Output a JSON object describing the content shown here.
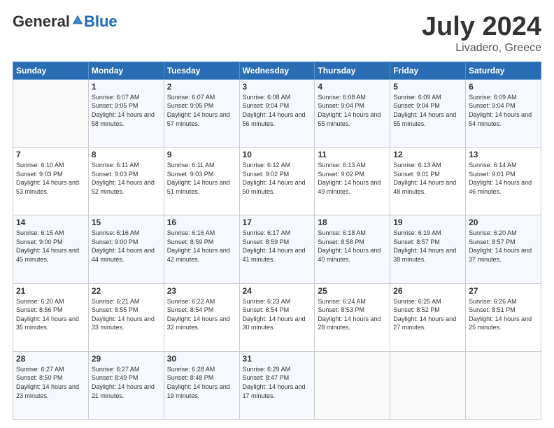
{
  "header": {
    "logo_general": "General",
    "logo_blue": "Blue",
    "title": "July 2024",
    "location": "Livadero, Greece"
  },
  "days_of_week": [
    "Sunday",
    "Monday",
    "Tuesday",
    "Wednesday",
    "Thursday",
    "Friday",
    "Saturday"
  ],
  "weeks": [
    [
      {
        "day": "",
        "sunrise": "",
        "sunset": "",
        "daylight": ""
      },
      {
        "day": "1",
        "sunrise": "Sunrise: 6:07 AM",
        "sunset": "Sunset: 9:05 PM",
        "daylight": "Daylight: 14 hours and 58 minutes."
      },
      {
        "day": "2",
        "sunrise": "Sunrise: 6:07 AM",
        "sunset": "Sunset: 9:05 PM",
        "daylight": "Daylight: 14 hours and 57 minutes."
      },
      {
        "day": "3",
        "sunrise": "Sunrise: 6:08 AM",
        "sunset": "Sunset: 9:04 PM",
        "daylight": "Daylight: 14 hours and 56 minutes."
      },
      {
        "day": "4",
        "sunrise": "Sunrise: 6:08 AM",
        "sunset": "Sunset: 9:04 PM",
        "daylight": "Daylight: 14 hours and 55 minutes."
      },
      {
        "day": "5",
        "sunrise": "Sunrise: 6:09 AM",
        "sunset": "Sunset: 9:04 PM",
        "daylight": "Daylight: 14 hours and 55 minutes."
      },
      {
        "day": "6",
        "sunrise": "Sunrise: 6:09 AM",
        "sunset": "Sunset: 9:04 PM",
        "daylight": "Daylight: 14 hours and 54 minutes."
      }
    ],
    [
      {
        "day": "7",
        "sunrise": "Sunrise: 6:10 AM",
        "sunset": "Sunset: 9:03 PM",
        "daylight": "Daylight: 14 hours and 53 minutes."
      },
      {
        "day": "8",
        "sunrise": "Sunrise: 6:11 AM",
        "sunset": "Sunset: 9:03 PM",
        "daylight": "Daylight: 14 hours and 52 minutes."
      },
      {
        "day": "9",
        "sunrise": "Sunrise: 6:11 AM",
        "sunset": "Sunset: 9:03 PM",
        "daylight": "Daylight: 14 hours and 51 minutes."
      },
      {
        "day": "10",
        "sunrise": "Sunrise: 6:12 AM",
        "sunset": "Sunset: 9:02 PM",
        "daylight": "Daylight: 14 hours and 50 minutes."
      },
      {
        "day": "11",
        "sunrise": "Sunrise: 6:13 AM",
        "sunset": "Sunset: 9:02 PM",
        "daylight": "Daylight: 14 hours and 49 minutes."
      },
      {
        "day": "12",
        "sunrise": "Sunrise: 6:13 AM",
        "sunset": "Sunset: 9:01 PM",
        "daylight": "Daylight: 14 hours and 48 minutes."
      },
      {
        "day": "13",
        "sunrise": "Sunrise: 6:14 AM",
        "sunset": "Sunset: 9:01 PM",
        "daylight": "Daylight: 14 hours and 46 minutes."
      }
    ],
    [
      {
        "day": "14",
        "sunrise": "Sunrise: 6:15 AM",
        "sunset": "Sunset: 9:00 PM",
        "daylight": "Daylight: 14 hours and 45 minutes."
      },
      {
        "day": "15",
        "sunrise": "Sunrise: 6:16 AM",
        "sunset": "Sunset: 9:00 PM",
        "daylight": "Daylight: 14 hours and 44 minutes."
      },
      {
        "day": "16",
        "sunrise": "Sunrise: 6:16 AM",
        "sunset": "Sunset: 8:59 PM",
        "daylight": "Daylight: 14 hours and 42 minutes."
      },
      {
        "day": "17",
        "sunrise": "Sunrise: 6:17 AM",
        "sunset": "Sunset: 8:59 PM",
        "daylight": "Daylight: 14 hours and 41 minutes."
      },
      {
        "day": "18",
        "sunrise": "Sunrise: 6:18 AM",
        "sunset": "Sunset: 8:58 PM",
        "daylight": "Daylight: 14 hours and 40 minutes."
      },
      {
        "day": "19",
        "sunrise": "Sunrise: 6:19 AM",
        "sunset": "Sunset: 8:57 PM",
        "daylight": "Daylight: 14 hours and 38 minutes."
      },
      {
        "day": "20",
        "sunrise": "Sunrise: 6:20 AM",
        "sunset": "Sunset: 8:57 PM",
        "daylight": "Daylight: 14 hours and 37 minutes."
      }
    ],
    [
      {
        "day": "21",
        "sunrise": "Sunrise: 6:20 AM",
        "sunset": "Sunset: 8:56 PM",
        "daylight": "Daylight: 14 hours and 35 minutes."
      },
      {
        "day": "22",
        "sunrise": "Sunrise: 6:21 AM",
        "sunset": "Sunset: 8:55 PM",
        "daylight": "Daylight: 14 hours and 33 minutes."
      },
      {
        "day": "23",
        "sunrise": "Sunrise: 6:22 AM",
        "sunset": "Sunset: 8:54 PM",
        "daylight": "Daylight: 14 hours and 32 minutes."
      },
      {
        "day": "24",
        "sunrise": "Sunrise: 6:23 AM",
        "sunset": "Sunset: 8:54 PM",
        "daylight": "Daylight: 14 hours and 30 minutes."
      },
      {
        "day": "25",
        "sunrise": "Sunrise: 6:24 AM",
        "sunset": "Sunset: 8:53 PM",
        "daylight": "Daylight: 14 hours and 28 minutes."
      },
      {
        "day": "26",
        "sunrise": "Sunrise: 6:25 AM",
        "sunset": "Sunset: 8:52 PM",
        "daylight": "Daylight: 14 hours and 27 minutes."
      },
      {
        "day": "27",
        "sunrise": "Sunrise: 6:26 AM",
        "sunset": "Sunset: 8:51 PM",
        "daylight": "Daylight: 14 hours and 25 minutes."
      }
    ],
    [
      {
        "day": "28",
        "sunrise": "Sunrise: 6:27 AM",
        "sunset": "Sunset: 8:50 PM",
        "daylight": "Daylight: 14 hours and 23 minutes."
      },
      {
        "day": "29",
        "sunrise": "Sunrise: 6:27 AM",
        "sunset": "Sunset: 8:49 PM",
        "daylight": "Daylight: 14 hours and 21 minutes."
      },
      {
        "day": "30",
        "sunrise": "Sunrise: 6:28 AM",
        "sunset": "Sunset: 8:48 PM",
        "daylight": "Daylight: 14 hours and 19 minutes."
      },
      {
        "day": "31",
        "sunrise": "Sunrise: 6:29 AM",
        "sunset": "Sunset: 8:47 PM",
        "daylight": "Daylight: 14 hours and 17 minutes."
      },
      {
        "day": "",
        "sunrise": "",
        "sunset": "",
        "daylight": ""
      },
      {
        "day": "",
        "sunrise": "",
        "sunset": "",
        "daylight": ""
      },
      {
        "day": "",
        "sunrise": "",
        "sunset": "",
        "daylight": ""
      }
    ]
  ]
}
